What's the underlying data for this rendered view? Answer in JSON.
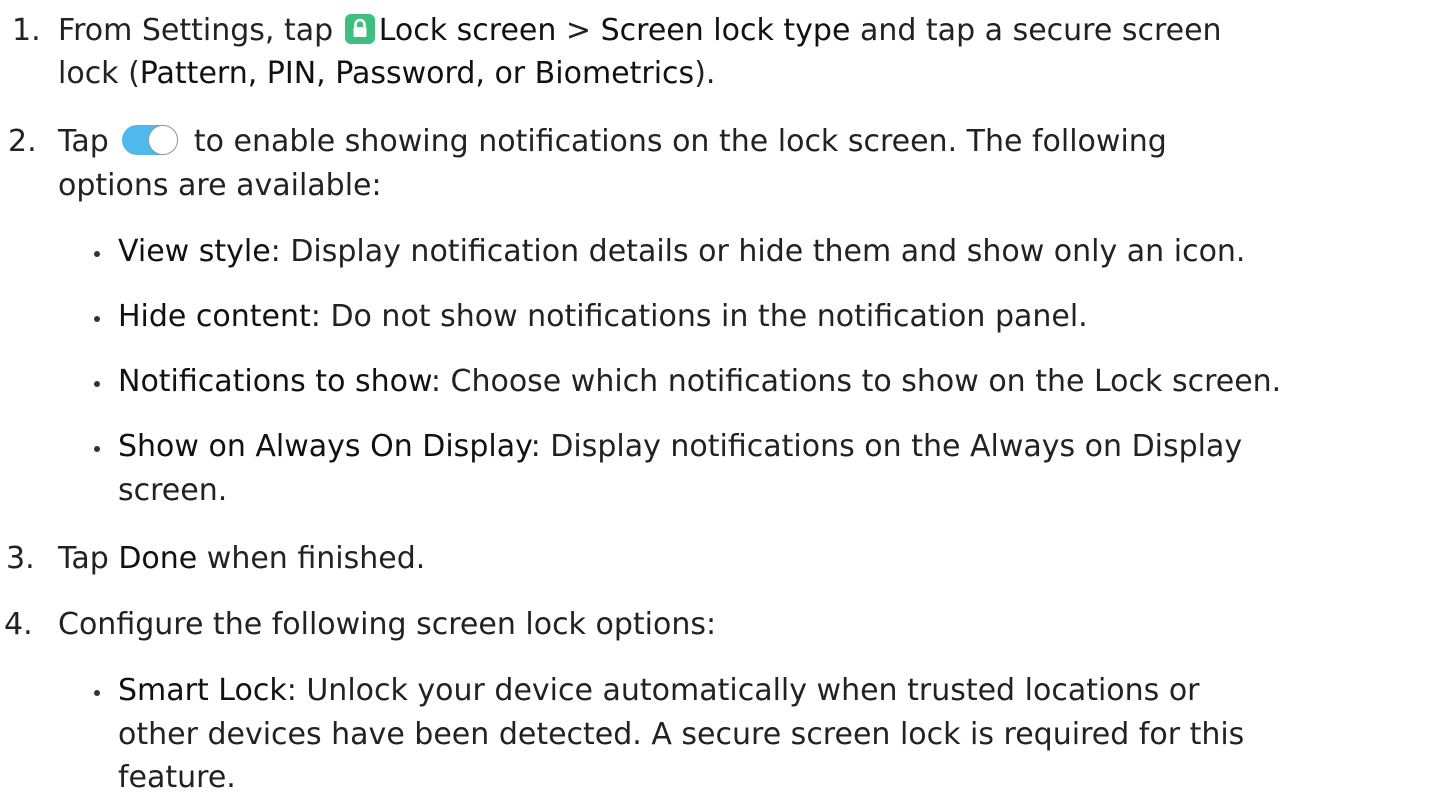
{
  "steps": [
    {
      "number": "1.",
      "line1": {
        "prefix": "From Settings, tap ",
        "term1": "Lock screen",
        "sep": " > ",
        "term2": "Screen lock type",
        "suffix": " and tap a secure screen"
      },
      "line2": {
        "prefix": "lock (",
        "term": "Pattern, PIN, Password, or Biometrics",
        "suffix": ")."
      }
    },
    {
      "number": "2.",
      "line1": {
        "prefix": "Tap ",
        "suffix": " to enable showing notifications on the lock screen. The following"
      },
      "line2": "options are available:",
      "bullets": [
        {
          "term": "View style",
          "text": ": Display notification details or hide them and show only an icon."
        },
        {
          "term": "Hide content",
          "text": ": Do not show notifications in the notification panel."
        },
        {
          "term": "Notifications to show",
          "text": ": Choose which notifications to show on the Lock screen."
        },
        {
          "term": "Show on Always On Display",
          "text": ": Display notifications on the Always on Display",
          "cont": "screen."
        }
      ]
    },
    {
      "number": "3.",
      "prefix": "Tap ",
      "term": "Done",
      "suffix": " when finished."
    },
    {
      "number": "4.",
      "text": "Configure the following screen lock options:",
      "bullets": [
        {
          "term": "Smart Lock",
          "text": ": Unlock your device automatically when trusted locations or",
          "cont1": "other devices have been detected. A secure screen lock is required for this",
          "cont2": "feature."
        }
      ]
    }
  ],
  "icons": {
    "lock": "lock-icon",
    "toggle": "toggle-icon"
  },
  "colors": {
    "lock_icon_bg": "#3fbf7f",
    "toggle_bg": "#4fb8ec"
  }
}
